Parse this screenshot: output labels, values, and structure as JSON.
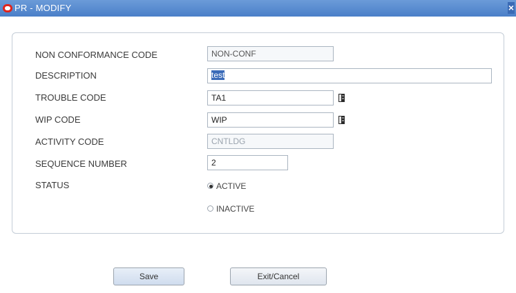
{
  "window": {
    "title": "PR - MODIFY"
  },
  "form": {
    "nonconformance_label": "NON CONFORMANCE CODE",
    "nonconformance_value": "NON-CONF",
    "description_label": "DESCRIPTION",
    "description_value": "test",
    "trouble_label": "TROUBLE CODE",
    "trouble_value": "TA1",
    "wip_label": "WIP CODE",
    "wip_value": "WIP",
    "activity_label": "ACTIVITY CODE",
    "activity_value": "CNTLDG",
    "sequence_label": "SEQUENCE NUMBER",
    "sequence_value": "2",
    "status_label": "STATUS",
    "status_options": [
      "ACTIVE",
      "INACTIVE"
    ],
    "status_selected": "ACTIVE"
  },
  "buttons": {
    "save": "Save",
    "exit": "Exit/Cancel"
  },
  "icons": {
    "close": "close-icon",
    "lookup": "lookup-icon",
    "logo": "oracle-logo-icon"
  },
  "colors": {
    "titlebar": "#4a7fc8",
    "selection": "#3b6bb8",
    "logo": "#e0241c"
  }
}
